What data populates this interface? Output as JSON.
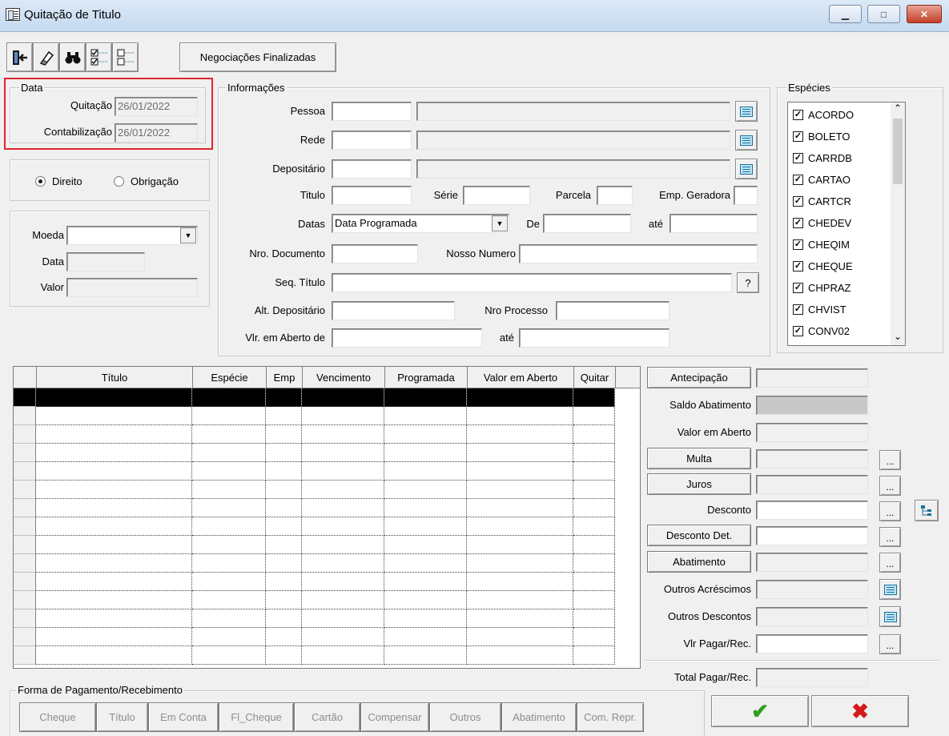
{
  "window": {
    "title": "Quitação de Titulo",
    "minimize_glyph": "▁",
    "maximize_glyph": "□",
    "close_glyph": "✕"
  },
  "toolbar": {
    "icons": [
      "exit-icon",
      "eraser-icon",
      "binoculars-icon",
      "check-all-icon",
      "uncheck-all-icon"
    ],
    "negociacoes_label": "Negociações Finalizadas"
  },
  "data_group": {
    "legend": "Data",
    "quitacao_label": "Quitação",
    "quitacao_value": "26/01/2022",
    "contabilizacao_label": "Contabilização",
    "contabilizacao_value": "26/01/2022"
  },
  "tipo": {
    "direito_label": "Direito",
    "obrigacao_label": "Obrigação",
    "selected": "Direito"
  },
  "moeda_group": {
    "moeda_label": "Moeda",
    "moeda_value": "",
    "data_label": "Data",
    "data_value": "",
    "valor_label": "Valor",
    "valor_value": ""
  },
  "info": {
    "legend": "Informações",
    "pessoa_label": "Pessoa",
    "rede_label": "Rede",
    "depositario_label": "Depositário",
    "titulo_label": "Titulo",
    "serie_label": "Série",
    "parcela_label": "Parcela",
    "emp_geradora_label": "Emp. Geradora",
    "datas_label": "Datas",
    "datas_value": "Data Programada",
    "de_label": "De",
    "ate_label": "até",
    "nro_documento_label": "Nro. Documento",
    "nosso_numero_label": "Nosso Numero",
    "seq_titulo_label": "Seq. Título",
    "help_button": "?",
    "alt_depositario_label": "Alt. Depositário",
    "nro_processo_label": "Nro Processo",
    "vlr_aberto_label": "Vlr. em Aberto de",
    "vlr_ate_label": "até"
  },
  "especies": {
    "legend": "Espécies",
    "items": [
      "ACORDO",
      "BOLETO",
      "CARRDB",
      "CARTAO",
      "CARTCR",
      "CHEDEV",
      "CHEQIM",
      "CHEQUE",
      "CHPRAZ",
      "CHVIST",
      "CONV02"
    ],
    "check_glyph": "✓",
    "scroll_up": "⌃",
    "scroll_down": "⌄"
  },
  "grid": {
    "columns": [
      "Título",
      "Espécie",
      "Emp",
      "Vencimento",
      "Programada",
      "Valor em Aberto",
      "Quitar"
    ]
  },
  "side": {
    "antecipacao_button": "Antecipação",
    "saldo_abatimento_label": "Saldo Abatimento",
    "valor_em_aberto_label": "Valor em Aberto",
    "multa_button": "Multa",
    "juros_button": "Juros",
    "desconto_label": "Desconto",
    "desconto_det_button": "Desconto Det.",
    "abatimento_button": "Abatimento",
    "outros_acrescimos_label": "Outros Acréscimos",
    "outros_descontos_label": "Outros Descontos",
    "vlr_pagar_label": "Vlr Pagar/Rec.",
    "total_pagar_label": "Total Pagar/Rec.",
    "dots": "..."
  },
  "forma_pagamento": {
    "legend": "Forma de Pagamento/Recebimento",
    "buttons": [
      "Cheque",
      "Título",
      "Em Conta",
      "Fl_Cheque",
      "Cartão",
      "Compensar",
      "Outros",
      "Abatimento",
      "Com. Repr."
    ]
  },
  "actions": {
    "confirm_glyph": "✔",
    "cancel_glyph": "✖",
    "confirm_color": "#2e9e1e",
    "cancel_color": "#d41a1a"
  }
}
